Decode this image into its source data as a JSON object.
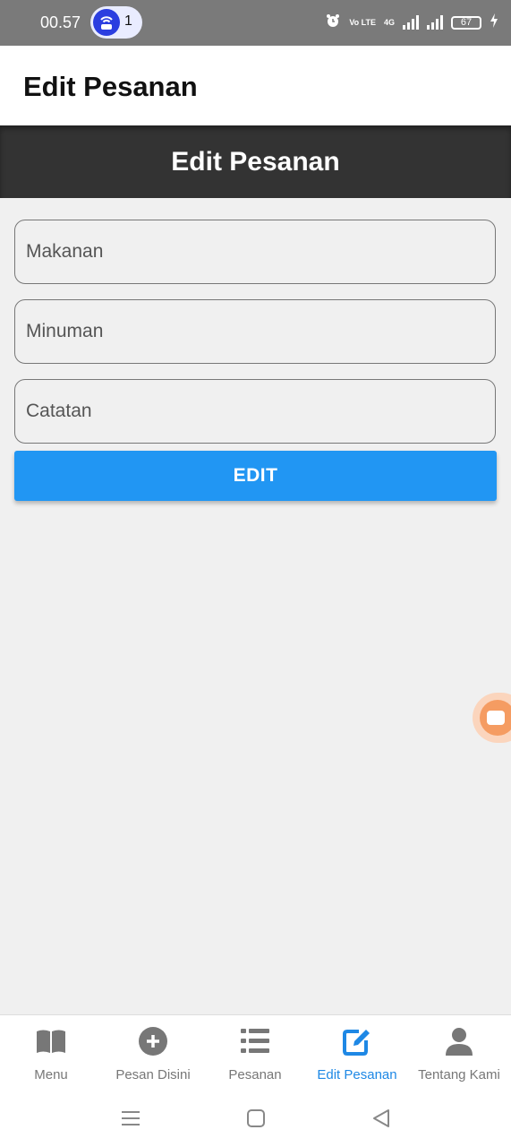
{
  "status_bar": {
    "time": "00.57",
    "notification_count": "1",
    "network_labels": [
      "Vo LTE",
      "4G"
    ],
    "battery": "67"
  },
  "app_bar": {
    "title": "Edit Pesanan"
  },
  "header": {
    "title": "Edit Pesanan"
  },
  "form": {
    "makanan": {
      "placeholder": "Makanan",
      "value": ""
    },
    "minuman": {
      "placeholder": "Minuman",
      "value": ""
    },
    "catatan": {
      "placeholder": "Catatan",
      "value": ""
    },
    "submit_label": "EDIT"
  },
  "bottom_nav": {
    "active": "Edit Pesanan",
    "items": [
      {
        "label": "Menu",
        "icon": "book-icon"
      },
      {
        "label": "Pesan Disini",
        "icon": "plus-circle-icon"
      },
      {
        "label": "Pesanan",
        "icon": "list-icon"
      },
      {
        "label": "Edit Pesanan",
        "icon": "edit-icon"
      },
      {
        "label": "Tentang Kami",
        "icon": "user-icon"
      }
    ]
  },
  "colors": {
    "accent": "#2196f3",
    "header_band": "#333333",
    "active_nav": "#1e88e5",
    "inactive_nav": "#777777"
  }
}
